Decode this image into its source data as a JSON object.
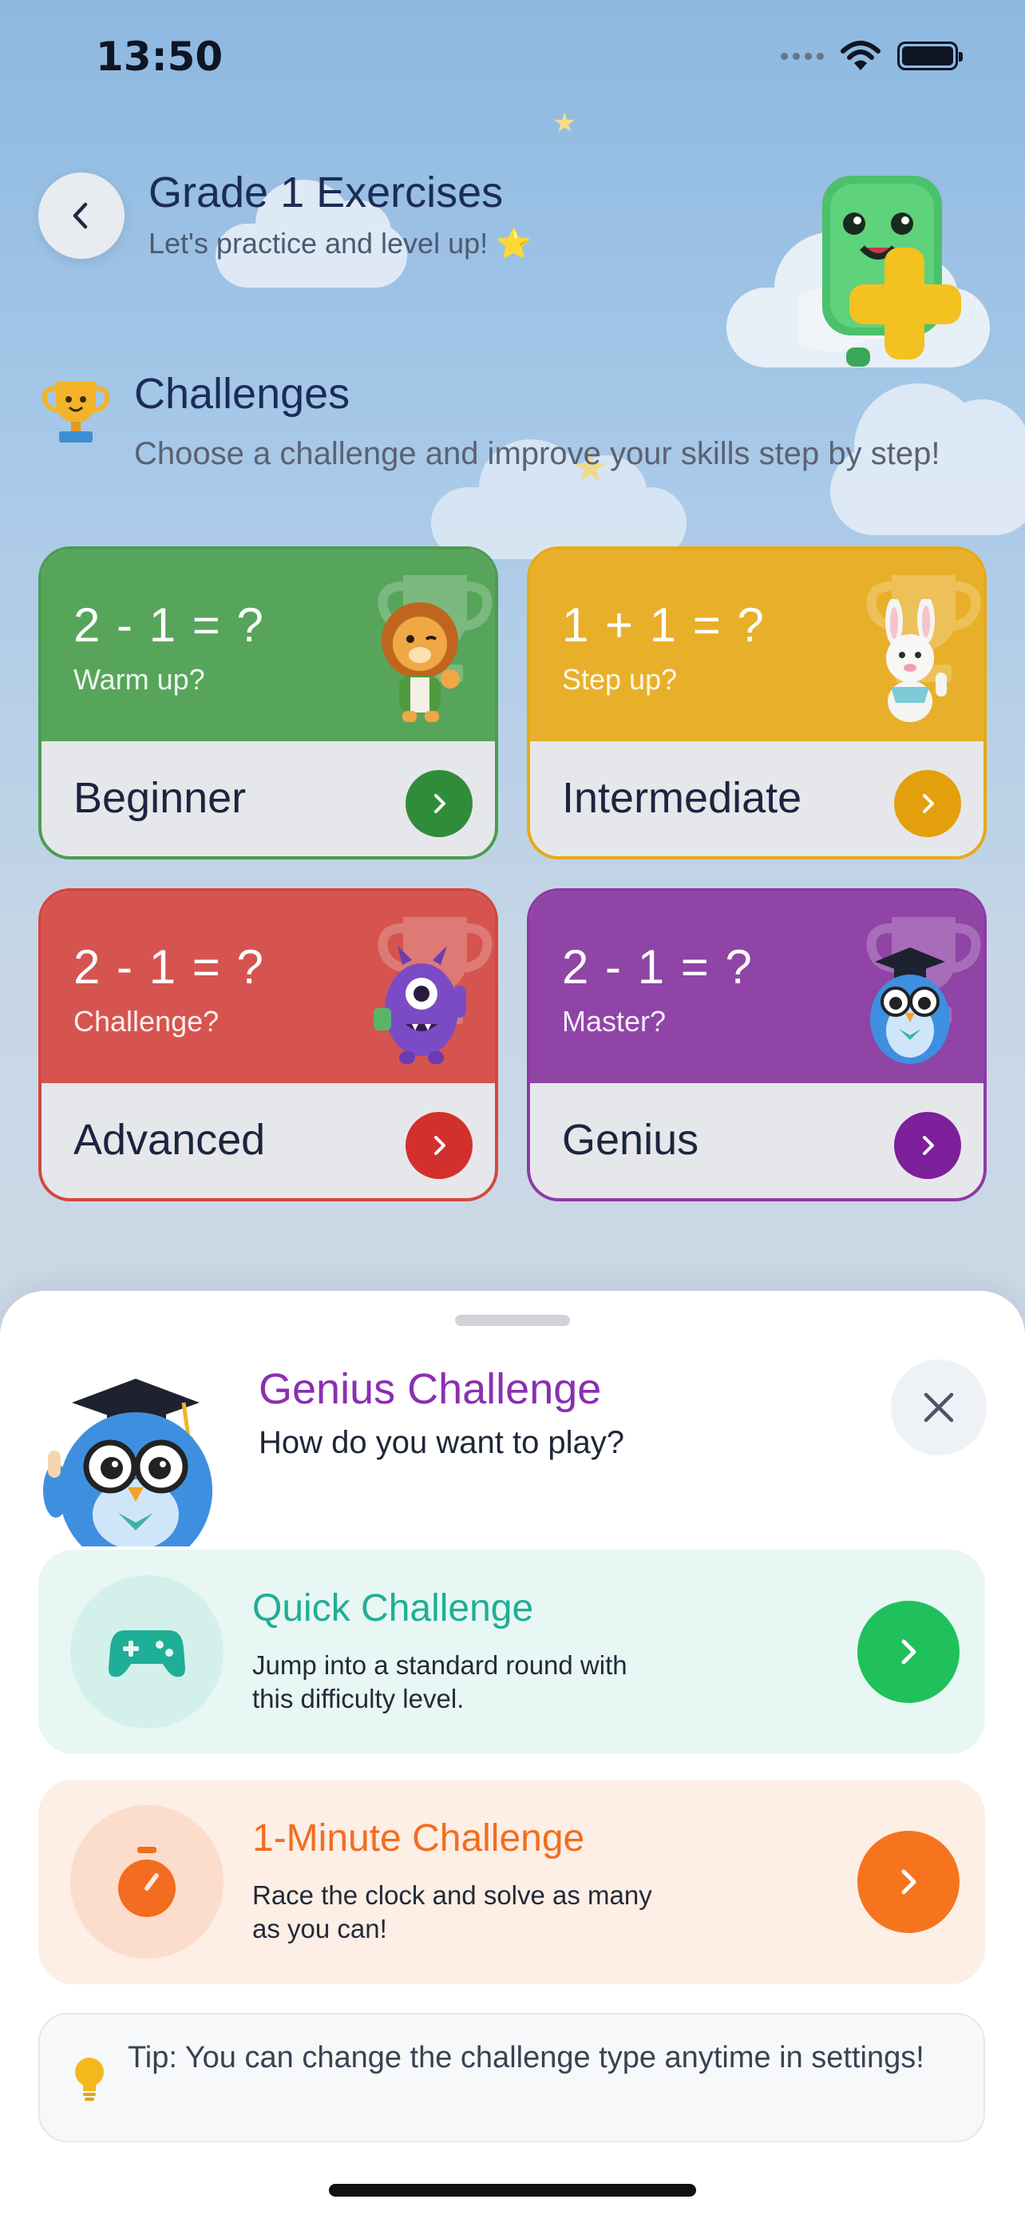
{
  "status_bar": {
    "time": "13:50"
  },
  "header": {
    "title": "Grade 1 Exercises",
    "subtitle": "Let's practice and level up! ⭐"
  },
  "challenges": {
    "title": "Challenges",
    "description": "Choose a challenge and improve your skills step by step!",
    "cards": [
      {
        "id": "beginner",
        "equation": "2 - 1 = ?",
        "hint": "Warm up?",
        "level": "Beginner",
        "color": "#57a55b",
        "character": "lion-icon"
      },
      {
        "id": "intermediate",
        "equation": "1 + 1 = ?",
        "hint": "Step up?",
        "level": "Intermediate",
        "color": "#e8b02a",
        "character": "bunny-icon"
      },
      {
        "id": "advanced",
        "equation": "2 - 1 = ?",
        "hint": "Challenge?",
        "level": "Advanced",
        "color": "#d55450",
        "character": "monster-icon"
      },
      {
        "id": "genius",
        "equation": "2 - 1 = ?",
        "hint": "Master?",
        "level": "Genius",
        "color": "#8f44a6",
        "character": "owl-icon"
      }
    ]
  },
  "sheet": {
    "title": "Genius Challenge",
    "subtitle": "How do you want to play?",
    "options": [
      {
        "id": "quick",
        "title": "Quick Challenge",
        "description": "Jump into a standard round with this difficulty level.",
        "icon": "gamepad-icon",
        "color": "#1fae97"
      },
      {
        "id": "minute",
        "title": "1-Minute Challenge",
        "description": "Race the clock and solve as many as you can!",
        "icon": "stopwatch-icon",
        "color": "#f26d1f"
      }
    ],
    "tip": "Tip: You can change the challenge type anytime in settings!"
  }
}
